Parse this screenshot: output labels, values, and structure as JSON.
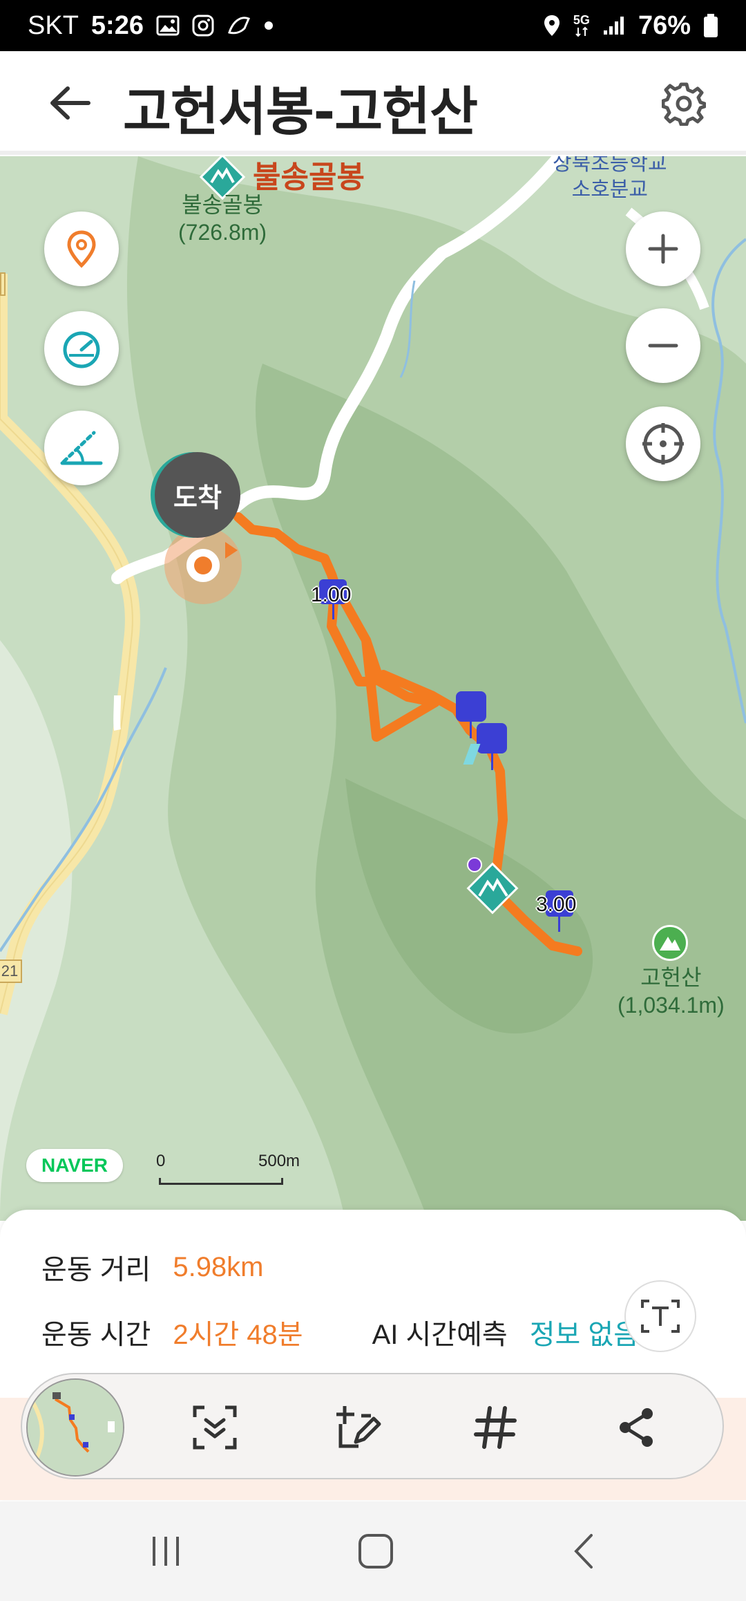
{
  "status_bar": {
    "carrier": "SKT",
    "time": "5:26",
    "network": "5G",
    "battery": "76%"
  },
  "header": {
    "title": "고헌서봉-고헌산",
    "back_icon": "arrow-left-icon",
    "settings_icon": "gear-icon"
  },
  "map": {
    "peak_left_name": "불송골봉",
    "peak_left_label": "불송골봉",
    "peak_left_elevation": "(726.8m)",
    "school_line1": "상북초등학교",
    "school_line2": "소호분교",
    "arrival_badge": "도착",
    "marker_1": "1.00",
    "marker_3": "3.00",
    "peak_right_name": "고헌산",
    "peak_right_elevation": "(1,034.1m)",
    "road_number_right": "21",
    "naver_logo": "NAVER",
    "scale_start": "0",
    "scale_end": "500m",
    "colors": {
      "track": "#f47b20",
      "marker": "#3b3fd4",
      "teal": "#2aa89a"
    }
  },
  "stats": {
    "distance_label": "운동 거리",
    "distance_value": "5.98km",
    "time_label": "운동 시간",
    "time_value": "2시간 48분",
    "ai_label": "AI 시간예측",
    "ai_value": "정보 없음"
  },
  "toolbar": {
    "items": [
      "map-thumbnail",
      "capture-icon",
      "add-post-icon",
      "hashtag-icon",
      "share-icon"
    ]
  },
  "navbar": {
    "items": [
      "recent-apps-icon",
      "home-icon",
      "back-icon"
    ]
  }
}
